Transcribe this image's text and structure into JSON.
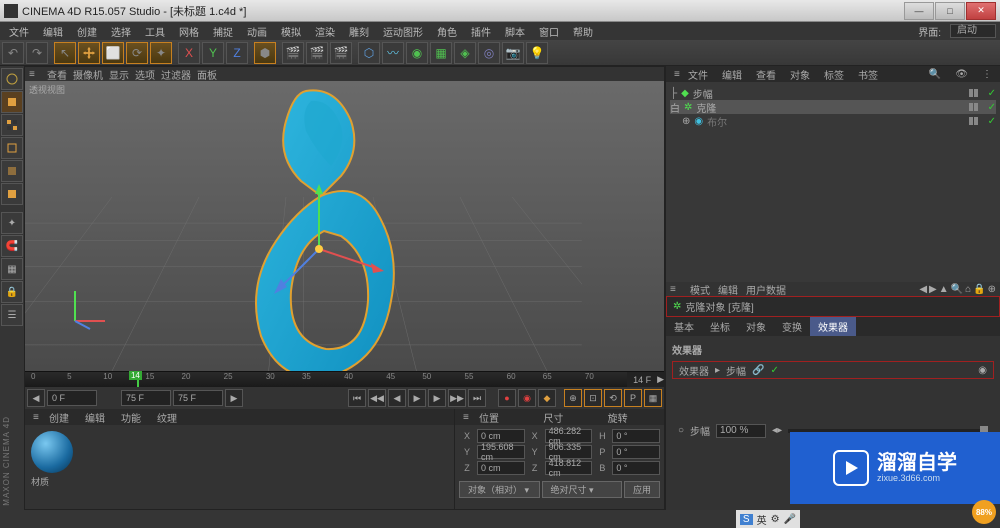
{
  "window": {
    "title": "CINEMA 4D R15.057 Studio - [未标题 1.c4d *]"
  },
  "menu": {
    "items": [
      "文件",
      "编辑",
      "创建",
      "选择",
      "工具",
      "网格",
      "捕捉",
      "动画",
      "模拟",
      "渲染",
      "雕刻",
      "运动图形",
      "角色",
      "插件",
      "脚本",
      "窗口",
      "帮助"
    ],
    "layout_label": "界面:",
    "layout_value": "启动"
  },
  "viewport": {
    "menu": [
      "查看",
      "摄像机",
      "显示",
      "选项",
      "过滤器",
      "面板"
    ],
    "label": "透视视图"
  },
  "timeline": {
    "current": "14",
    "end_label": "14 F",
    "start": "0 F",
    "t_end": "75 F",
    "t_end2": "75 F"
  },
  "material": {
    "tabs": [
      "创建",
      "编辑",
      "功能",
      "纹理"
    ],
    "name": "材质"
  },
  "coords": {
    "headers": [
      "位置",
      "尺寸",
      "旋转"
    ],
    "x_pos": "0 cm",
    "x_size": "486.282 cm",
    "x_rot": "0 °",
    "y_pos": "195.608 cm",
    "y_size": "906.335 cm",
    "y_rot": "0 °",
    "z_pos": "0 cm",
    "z_size": "418.812 cm",
    "z_rot": "0 °",
    "mode1": "对象（相对）",
    "mode2": "绝对尺寸",
    "apply": "应用"
  },
  "objects": {
    "tabs": [
      "文件",
      "编辑",
      "查看",
      "对象",
      "标签",
      "书签"
    ],
    "items": [
      {
        "name": "步幅",
        "icon": "green"
      },
      {
        "name": "克隆",
        "icon": "green",
        "sel": true
      },
      {
        "name": "布尔",
        "icon": "cyan",
        "indent": true
      }
    ]
  },
  "attr": {
    "header": [
      "模式",
      "编辑",
      "用户数据"
    ],
    "title": "克隆对象 [克隆]",
    "tabs": [
      "基本",
      "坐标",
      "对象",
      "变换",
      "效果器"
    ],
    "active_tab": "效果器",
    "section": "效果器",
    "eff_label": "效果器",
    "eff_item": "步幅",
    "slider_label": "步幅",
    "slider_value": "100 %"
  },
  "watermark": {
    "main": "溜溜自学",
    "sub": "zixue.3d66.com"
  },
  "badge": "88%",
  "maxon": "MAXON CINEMA 4D",
  "taskbar": {
    "ime": "英"
  }
}
